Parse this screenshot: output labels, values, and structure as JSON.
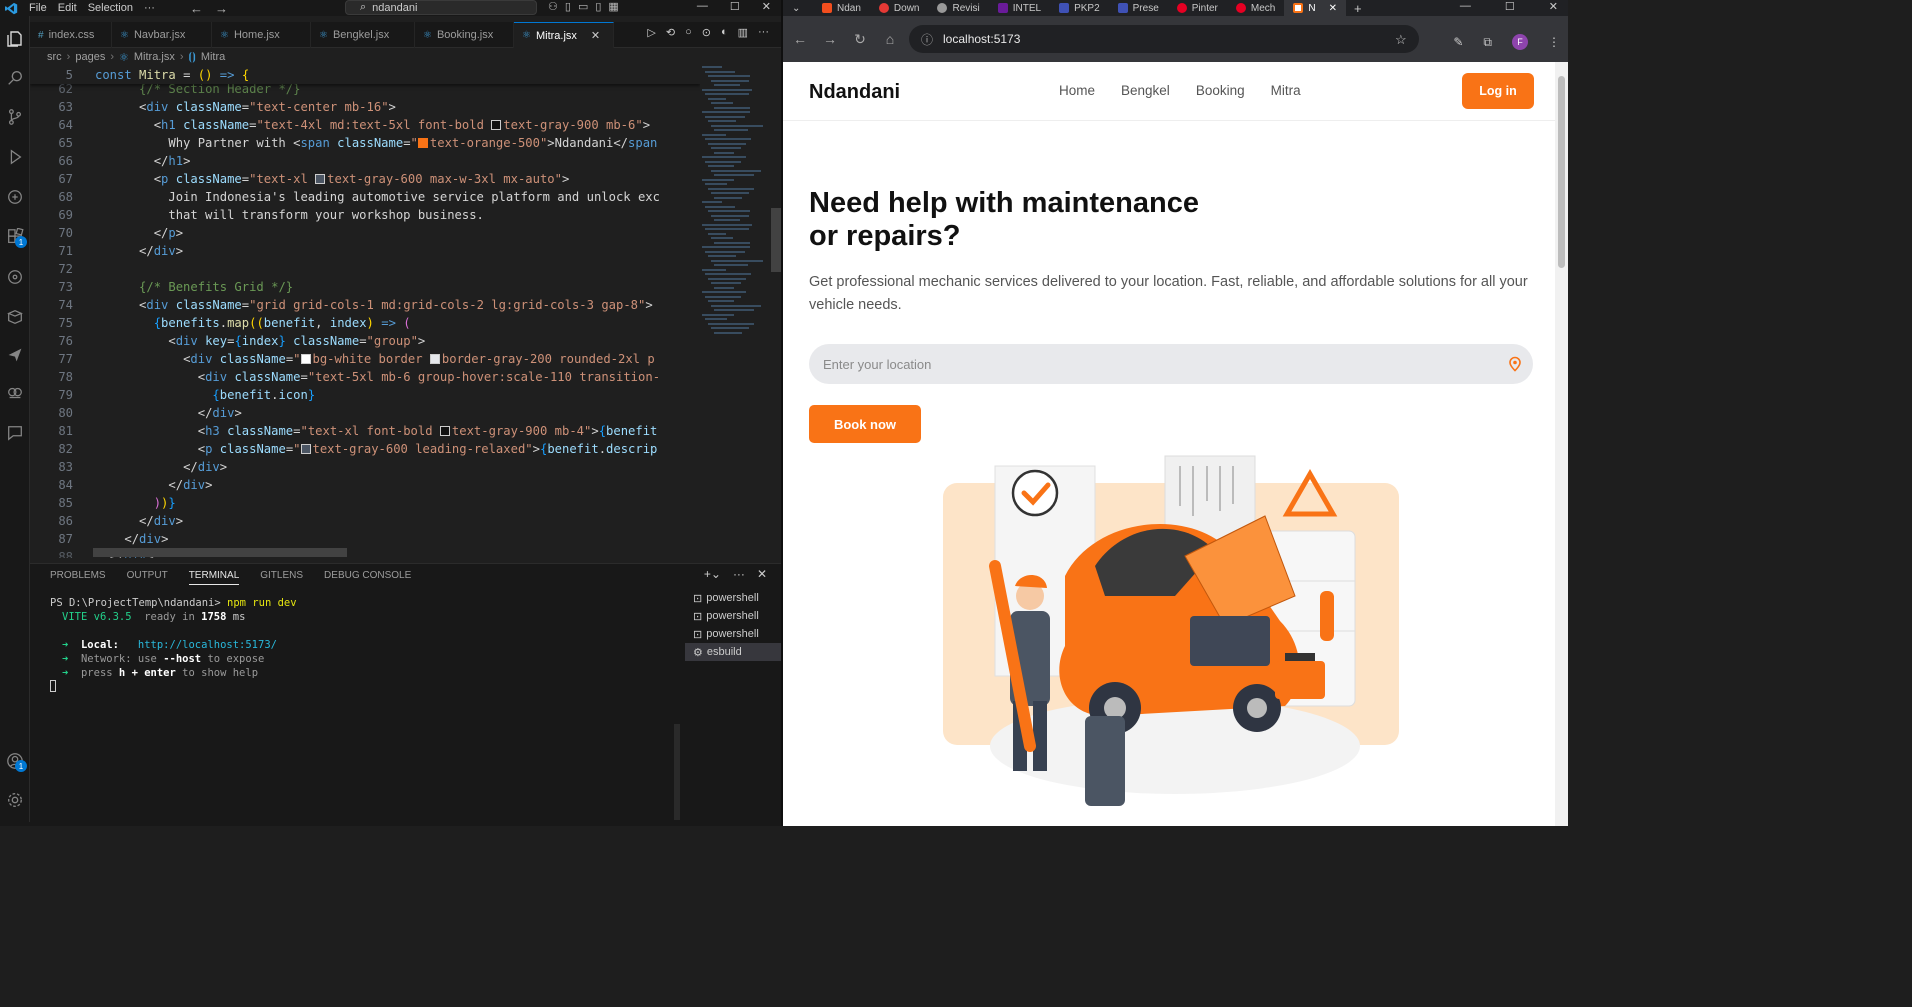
{
  "vscode": {
    "menus": [
      "File",
      "Edit",
      "Selection",
      "···"
    ],
    "command_center": "ndandani",
    "tabs": [
      {
        "label": "index.css",
        "icon": "#"
      },
      {
        "label": "Navbar.jsx",
        "icon": "⚛"
      },
      {
        "label": "Home.jsx",
        "icon": "⚛"
      },
      {
        "label": "Bengkel.jsx",
        "icon": "⚛"
      },
      {
        "label": "Booking.jsx",
        "icon": "⚛"
      },
      {
        "label": "Mitra.jsx",
        "icon": "⚛",
        "active": true
      }
    ],
    "breadcrumb": [
      "src",
      "pages",
      "Mitra.jsx",
      "Mitra"
    ],
    "activity_badges": {
      "extensions": "1",
      "accounts": "1"
    },
    "panel_tabs": [
      "PROBLEMS",
      "OUTPUT",
      "TERMINAL",
      "GITLENS",
      "DEBUG CONSOLE"
    ],
    "active_panel_tab": "TERMINAL",
    "terminal_list": [
      "powershell",
      "powershell",
      "powershell",
      "esbuild"
    ],
    "active_terminal": "esbuild",
    "terminal": {
      "prompt": "PS D:\\ProjectTemp\\ndandani> ",
      "command": "npm run dev",
      "vite_name": "VITE",
      "vite_version": "v6.3.5",
      "ready_text": "ready in",
      "ready_ms": "1758",
      "ms_unit": "ms",
      "local_label": "Local:",
      "local_url": "http://localhost:5173/",
      "network_label": "Network:",
      "network_pre": "use",
      "network_flag": "--host",
      "network_post": "to expose",
      "help_pre": "press",
      "help_key": "h + enter",
      "help_post": "to show help"
    }
  },
  "browser": {
    "tabs": [
      {
        "label": "Ndan",
        "color": "#f24e1e"
      },
      {
        "label": "Down",
        "color": "#e53935"
      },
      {
        "label": "Revisi",
        "color": "#999999"
      },
      {
        "label": "INTEL",
        "color": "#6a1b9a"
      },
      {
        "label": "PKP2",
        "color": "#3f51b5"
      },
      {
        "label": "Prese",
        "color": "#3f51b5"
      },
      {
        "label": "Pinter",
        "color": "#e60023"
      },
      {
        "label": "Mech",
        "color": "#e60023"
      },
      {
        "label": "N",
        "color": "#f97316",
        "active": true
      }
    ],
    "url": "localhost:5173",
    "profile_initial": "F"
  },
  "site": {
    "brand": "Ndandani",
    "nav": [
      "Home",
      "Bengkel",
      "Booking",
      "Mitra"
    ],
    "login_label": "Log in",
    "hero_title": "Need help with maintenance or repairs?",
    "hero_subtitle": "Get professional mechanic services delivered to your location. Fast, reliable, and affordable solutions for all your vehicle needs.",
    "location_placeholder": "Enter your location",
    "book_label": "Book now",
    "accent_color": "#f97316"
  }
}
